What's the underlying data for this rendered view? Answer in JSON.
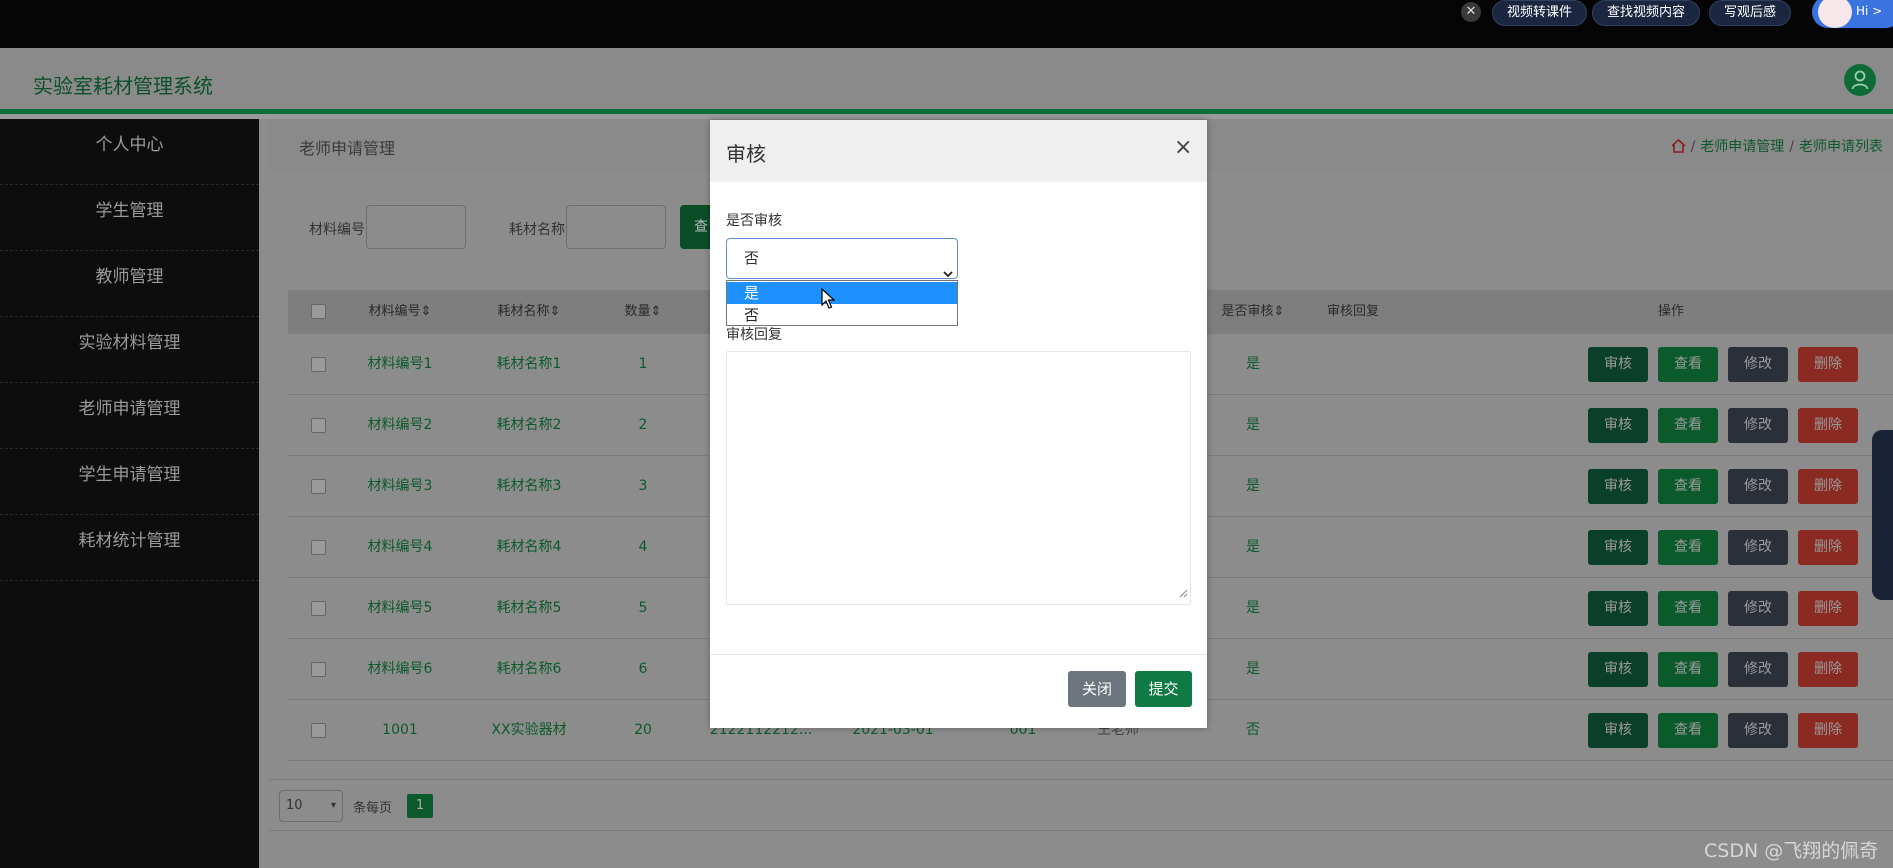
{
  "topbar": {
    "close_icon": "close-icon",
    "pills": [
      "视频转课件",
      "查找视频内容",
      "写观后感"
    ],
    "avatar_text": "Hi >"
  },
  "app": {
    "title": "实验室耗材管理系统"
  },
  "sidebar": {
    "items": [
      {
        "label": "个人中心"
      },
      {
        "label": "学生管理"
      },
      {
        "label": "教师管理"
      },
      {
        "label": "实验材料管理"
      },
      {
        "label": "老师申请管理"
      },
      {
        "label": "学生申请管理"
      },
      {
        "label": "耗材统计管理"
      }
    ]
  },
  "page": {
    "section_title": "老师申请管理",
    "breadcrumb": [
      "老师申请管理",
      "老师申请列表"
    ]
  },
  "search": {
    "field1_label": "材料编号",
    "field2_label": "耗材名称",
    "button_label": "查"
  },
  "table": {
    "headers": {
      "code": "材料编号",
      "name": "耗材名称",
      "qty": "数量",
      "audited": "是否审核",
      "reply": "审核回复",
      "actions": "操作"
    },
    "sort_icon": "sort-icon",
    "rows": [
      {
        "code": "材料编号1",
        "name": "耗材名称1",
        "qty": "1",
        "c4": "",
        "c5": "",
        "c6": "",
        "c7": "",
        "audited": "是"
      },
      {
        "code": "材料编号2",
        "name": "耗材名称2",
        "qty": "2",
        "c4": "",
        "c5": "",
        "c6": "",
        "c7": "",
        "audited": "是"
      },
      {
        "code": "材料编号3",
        "name": "耗材名称3",
        "qty": "3",
        "c4": "",
        "c5": "",
        "c6": "",
        "c7": "",
        "audited": "是"
      },
      {
        "code": "材料编号4",
        "name": "耗材名称4",
        "qty": "4",
        "c4": "",
        "c5": "",
        "c6": "",
        "c7": "",
        "audited": "是"
      },
      {
        "code": "材料编号5",
        "name": "耗材名称5",
        "qty": "5",
        "c4": "",
        "c5": "",
        "c6": "",
        "c7": "",
        "audited": "是"
      },
      {
        "code": "材料编号6",
        "name": "耗材名称6",
        "qty": "6",
        "c4": "",
        "c5": "",
        "c6": "",
        "c7": "",
        "audited": "是"
      },
      {
        "code": "1001",
        "name": "XX实验器材",
        "qty": "20",
        "c4": "2122112212...",
        "c5": "2021-03-01",
        "c6": "001",
        "c7": "王老师",
        "audited": "否"
      }
    ],
    "actions": {
      "audit": "审核",
      "view": "查看",
      "edit": "修改",
      "delete": "删除"
    }
  },
  "pager": {
    "page_size": "10",
    "per_page_label": "条每页",
    "current_page": "1"
  },
  "modal": {
    "title": "审核",
    "close_icon": "close-icon",
    "audit_label": "是否审核",
    "select_value": "否",
    "options": [
      "是",
      "否"
    ],
    "highlighted_option": "是",
    "reply_label": "审核回复",
    "reply_value": "",
    "close_button": "关闭",
    "submit_button": "提交"
  },
  "watermark": "CSDN @飞翔的佩奇",
  "colors": {
    "brand_green": "#0f7a43",
    "highlight_blue": "#1e90ff",
    "close_gray": "#6c757d"
  }
}
